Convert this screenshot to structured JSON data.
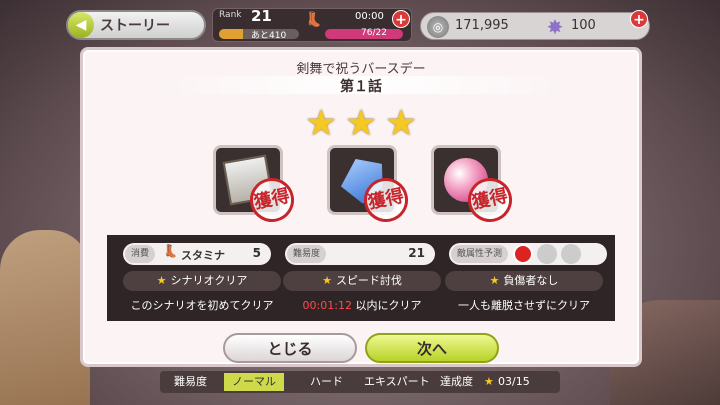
{
  "hud": {
    "back_label": "ストーリー",
    "rank_label": "Rank",
    "rank": "21",
    "rank_next": "あと410",
    "rank_fill": 0.3,
    "stamina_time": "00:00",
    "stamina_value": "76/22",
    "stamina_fill": 1.0,
    "coins": "171,995",
    "gems": "100"
  },
  "modal": {
    "title": "剣舞で祝うバースデー",
    "episode": "第１話",
    "stars": [
      "★",
      "★",
      "★"
    ],
    "reward_stamp": "獲得",
    "cost_tag": "消費",
    "stamina_label": "スタミナ",
    "stamina_cost": "5",
    "difficulty_tag": "難易度",
    "difficulty_value": "21",
    "enemy_tag": "敵属性予測",
    "conditions": [
      {
        "label": "シナリオクリア",
        "desc_pre": "このシナリオを初めてクリア",
        "time": "",
        "desc_post": ""
      },
      {
        "label": "スピード討伐",
        "desc_pre": "",
        "time": "00:01:12",
        "desc_post": " 以内にクリア"
      },
      {
        "label": "負傷者なし",
        "desc_pre": "一人も離脱させずにクリア",
        "time": "",
        "desc_post": ""
      }
    ],
    "close_label": "とじる",
    "next_label": "次へ"
  },
  "bottom": {
    "difficulty_label": "難易度",
    "normal": "ノーマル",
    "hard": "ハード",
    "expert": "エキスパート",
    "achievement_label": "達成度",
    "achievement_value": "03/15"
  },
  "colors": {
    "accent": "#b9d22a",
    "stamp": "#c8242b",
    "star": "#f5c823"
  }
}
